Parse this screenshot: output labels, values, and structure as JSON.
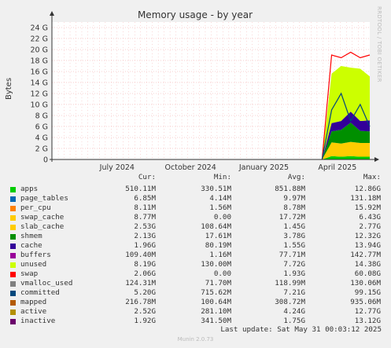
{
  "chart_data": {
    "type": "area",
    "title": "Memory usage - by year",
    "ylabel": "Bytes",
    "ylim": [
      0,
      25
    ],
    "yticks": [
      "0",
      "2 G",
      "4 G",
      "6 G",
      "8 G",
      "10 G",
      "12 G",
      "14 G",
      "16 G",
      "18 G",
      "20 G",
      "22 G",
      "24 G"
    ],
    "ytick_values": [
      0,
      2,
      4,
      6,
      8,
      10,
      12,
      14,
      16,
      18,
      20,
      22,
      24
    ],
    "xlabels": [
      "July 2024",
      "October 2024",
      "January 2025",
      "April 2025"
    ],
    "xlabel_positions": [
      0.205,
      0.436,
      0.667,
      0.898
    ],
    "grid": true,
    "data_start_fraction": 0.85,
    "series": [
      {
        "name": "apps",
        "color": "#00cc00",
        "approx_values": [
          0,
          0.6,
          0.5,
          0.6,
          0.5,
          0.5
        ]
      },
      {
        "name": "page_tables",
        "color": "#0066b3",
        "approx_values": [
          0,
          0.0,
          0.0,
          0.0,
          0.0,
          0.0
        ]
      },
      {
        "name": "per_cpu",
        "color": "#ff8000",
        "approx_values": [
          0,
          0.0,
          0.0,
          0.0,
          0.0,
          0.0
        ]
      },
      {
        "name": "slab_cache",
        "color": "#ffcc00",
        "approx_values": [
          0,
          2.5,
          2.4,
          2.6,
          2.5,
          2.5
        ]
      },
      {
        "name": "shmem",
        "color": "#008f00",
        "approx_values": [
          0,
          2.0,
          2.5,
          3.5,
          2.2,
          2.1
        ]
      },
      {
        "name": "cache",
        "color": "#330099",
        "approx_values": [
          0,
          1.5,
          1.6,
          2.0,
          1.8,
          2.0
        ]
      },
      {
        "name": "unused",
        "color": "#ccff00",
        "approx_values": [
          0,
          9.0,
          10.0,
          8.0,
          9.5,
          8.0
        ]
      }
    ],
    "overlay_lines": [
      {
        "name": "swap",
        "color": "#ff0000",
        "approx_values": [
          0,
          19,
          18.5,
          19.5,
          18.5,
          19
        ]
      },
      {
        "name": "committed",
        "color": "#00487d",
        "approx_values": [
          0,
          9,
          12,
          7,
          10,
          6
        ]
      }
    ]
  },
  "legend": {
    "header": {
      "cur": "Cur:",
      "min": "Min:",
      "avg": "Avg:",
      "max": "Max:"
    },
    "rows": [
      {
        "name": "apps",
        "color": "#00cc00",
        "cur": "510.11M",
        "min": "330.51M",
        "avg": "851.88M",
        "max": "12.86G"
      },
      {
        "name": "page_tables",
        "color": "#0066b3",
        "cur": "6.85M",
        "min": "4.14M",
        "avg": "9.97M",
        "max": "131.18M"
      },
      {
        "name": "per_cpu",
        "color": "#ff8000",
        "cur": "8.11M",
        "min": "1.56M",
        "avg": "8.78M",
        "max": "15.92M"
      },
      {
        "name": "swap_cache",
        "color": "#ffcc00",
        "cur": "8.77M",
        "min": "0.00",
        "avg": "17.72M",
        "max": "6.43G"
      },
      {
        "name": "slab_cache",
        "color": "#ffcc00",
        "cur": "2.53G",
        "min": "108.64M",
        "avg": "1.45G",
        "max": "2.77G"
      },
      {
        "name": "shmem",
        "color": "#008f00",
        "cur": "2.13G",
        "min": "17.61M",
        "avg": "3.78G",
        "max": "12.32G"
      },
      {
        "name": "cache",
        "color": "#330099",
        "cur": "1.96G",
        "min": "80.19M",
        "avg": "1.55G",
        "max": "13.94G"
      },
      {
        "name": "buffers",
        "color": "#990099",
        "cur": "109.40M",
        "min": "1.16M",
        "avg": "77.71M",
        "max": "142.77M"
      },
      {
        "name": "unused",
        "color": "#ccff00",
        "cur": "8.19G",
        "min": "130.00M",
        "avg": "7.72G",
        "max": "14.38G"
      },
      {
        "name": "swap",
        "color": "#ff0000",
        "cur": "2.06G",
        "min": "0.00",
        "avg": "1.93G",
        "max": "60.08G"
      },
      {
        "name": "vmalloc_used",
        "color": "#808080",
        "cur": "124.31M",
        "min": "71.70M",
        "avg": "118.99M",
        "max": "130.06M"
      },
      {
        "name": "committed",
        "color": "#00487d",
        "cur": "5.20G",
        "min": "715.62M",
        "avg": "7.21G",
        "max": "99.15G"
      },
      {
        "name": "mapped",
        "color": "#b35a00",
        "cur": "216.78M",
        "min": "100.64M",
        "avg": "308.72M",
        "max": "935.06M"
      },
      {
        "name": "active",
        "color": "#b38f00",
        "cur": "2.52G",
        "min": "281.10M",
        "avg": "4.24G",
        "max": "12.77G"
      },
      {
        "name": "inactive",
        "color": "#6b006b",
        "cur": "1.92G",
        "min": "341.50M",
        "avg": "1.75G",
        "max": "13.12G"
      }
    ]
  },
  "footer": {
    "last_update": "Last update: Sat May 31 00:03:12 2025",
    "munin": "Munin 2.0.73"
  },
  "watermark": "RRDTOOL / TOBI OETIKER"
}
